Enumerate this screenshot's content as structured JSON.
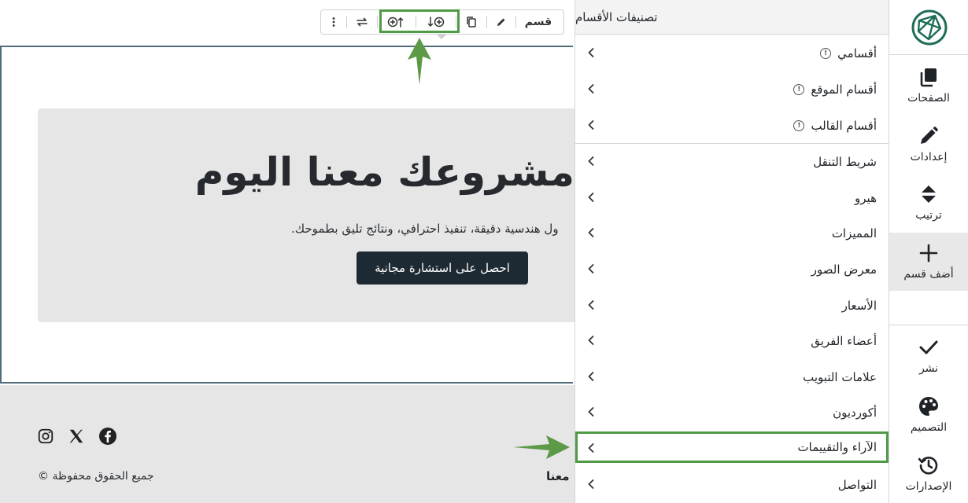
{
  "canvas": {
    "hero": {
      "title": "مشروعك معنا اليوم",
      "subtitle": "ول هندسية دقيقة، تنفيذ احترافي، ونتائج تليق بطموحك.",
      "cta_label": "احصل على استشارة مجانية"
    },
    "footer": {
      "copyright": "جميع الحقوق محفوظة ©",
      "partial_text": "معنا",
      "social_icons": [
        "instagram-icon",
        "x-icon",
        "facebook-icon"
      ]
    }
  },
  "toolbar": {
    "section_label": "قسم",
    "icons": [
      "more-vertical-icon",
      "swap-icon",
      "add-above-icon",
      "add-below-icon",
      "duplicate-icon",
      "edit-icon"
    ]
  },
  "panel": {
    "title": "تصنيفات الأقسام",
    "groups": [
      {
        "label": "أقسامي",
        "info": true
      },
      {
        "label": "أقسام الموقع",
        "info": true
      },
      {
        "label": "أقسام القالب",
        "info": true
      }
    ],
    "categories": [
      {
        "label": "شريط التنقل"
      },
      {
        "label": "هيرو"
      },
      {
        "label": "المميزات"
      },
      {
        "label": "معرض الصور"
      },
      {
        "label": "الأسعار"
      },
      {
        "label": "أعضاء الفريق"
      },
      {
        "label": "علامات التبويب"
      },
      {
        "label": "أكورديون"
      },
      {
        "label": "الآراء والتقييمات",
        "highlighted": true
      },
      {
        "label": "التواصل"
      }
    ]
  },
  "rail": {
    "items": [
      {
        "label": "الصفحات",
        "icon": "pages-icon"
      },
      {
        "label": "إعدادات",
        "icon": "pencil-icon"
      },
      {
        "label": "ترتيب",
        "icon": "sort-icon"
      },
      {
        "label": "أضف قسم",
        "icon": "plus-icon",
        "active": true
      }
    ],
    "bottom_items": [
      {
        "label": "نشر",
        "icon": "check-icon"
      },
      {
        "label": "التصميم",
        "icon": "palette-icon"
      },
      {
        "label": "الإصدارات",
        "icon": "history-icon"
      }
    ]
  },
  "colors": {
    "accent_highlight": "#4e9a45",
    "button_dark": "#1e2a33",
    "logo": "#1f6e5a"
  }
}
